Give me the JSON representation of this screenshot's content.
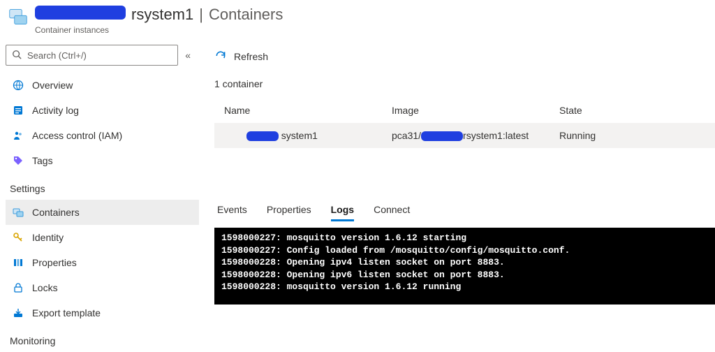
{
  "header": {
    "resource_suffix": "rsystem1",
    "separator": " | ",
    "page": "Containers",
    "subtitle": "Container instances"
  },
  "sidebar": {
    "search_placeholder": "Search (Ctrl+/)",
    "items": [
      {
        "label": "Overview",
        "icon": "globe"
      },
      {
        "label": "Activity log",
        "icon": "log"
      },
      {
        "label": "Access control (IAM)",
        "icon": "people"
      },
      {
        "label": "Tags",
        "icon": "tag"
      }
    ],
    "section_settings": "Settings",
    "settings_items": [
      {
        "label": "Containers",
        "icon": "containers",
        "selected": true
      },
      {
        "label": "Identity",
        "icon": "key"
      },
      {
        "label": "Properties",
        "icon": "properties"
      },
      {
        "label": "Locks",
        "icon": "lock"
      },
      {
        "label": "Export template",
        "icon": "export"
      }
    ],
    "section_monitoring": "Monitoring"
  },
  "toolbar": {
    "refresh": "Refresh"
  },
  "container_list": {
    "count_label": "1 container",
    "columns": {
      "name": "Name",
      "image": "Image",
      "state": "State"
    },
    "rows": [
      {
        "name_suffix": "system1",
        "image_prefix": "pca31/",
        "image_suffix": "rsystem1:latest",
        "state": "Running"
      }
    ]
  },
  "tabs": {
    "events": "Events",
    "properties": "Properties",
    "logs": "Logs",
    "connect": "Connect",
    "active": "logs"
  },
  "logs": [
    "1598000227: mosquitto version 1.6.12 starting",
    "1598000227: Config loaded from /mosquitto/config/mosquitto.conf.",
    "1598000228: Opening ipv4 listen socket on port 8883.",
    "1598000228: Opening ipv6 listen socket on port 8883.",
    "1598000228: mosquitto version 1.6.12 running"
  ]
}
